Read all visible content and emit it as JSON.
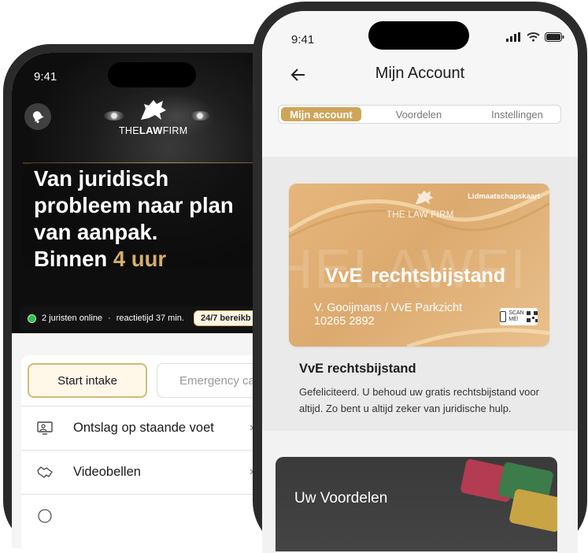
{
  "left_phone": {
    "status_time": "9:41",
    "logo": {
      "brand": "THE LAW FIRM",
      "part1": "THE",
      "part2": "LAW",
      "part3": "FIRM"
    },
    "headline": {
      "line1": "Van juridisch",
      "line2": "probleem naar plan",
      "line3": "van aanpak.",
      "line4_prefix": "Binnen",
      "line4_accent": "4 uur"
    },
    "status_bar": {
      "online": "2 juristen online",
      "dot": "·",
      "reaction": "reactietijd  37 min.",
      "badge": "24/7 bereikb"
    },
    "buttons": {
      "start": "Start intake",
      "emergency": "Emergency cal"
    },
    "list": [
      {
        "label": "Ontslag op staande voet",
        "icon": "monitor-person-icon"
      },
      {
        "label": "Videobellen",
        "icon": "handshake-icon"
      }
    ],
    "colors": {
      "accent_gold": "#d4ae6a",
      "online_green": "#2fbf4b"
    }
  },
  "right_phone": {
    "status_time": "9:41",
    "title": "Mijn Account",
    "tabs": [
      {
        "label": "Mijn account",
        "active": true
      },
      {
        "label": "Voordelen",
        "active": false
      },
      {
        "label": "Instellingen",
        "active": false
      }
    ],
    "membership_card": {
      "kind": "Lidmaatschapskaart",
      "logo": "THE LAW FIRM",
      "background_text": "HELAWFI",
      "title": "VvE  rechtsbijstand",
      "holder": "V. Gooijmans / VvE Parkzicht",
      "number": "10265 2892",
      "scan_line1": "SCAN",
      "scan_line2": "ME!"
    },
    "section": {
      "heading": "VvE rechtsbijstand",
      "body": "Gefeliciteerd. U behoud uw gratis rechtsbijstand voor altijd. Zo bent u altijd zeker van juridische hulp."
    },
    "voordelen_card_title": "Uw Voordelen",
    "colors": {
      "tab_active": "#cfa55a",
      "card_gold": "#e0b176"
    }
  }
}
